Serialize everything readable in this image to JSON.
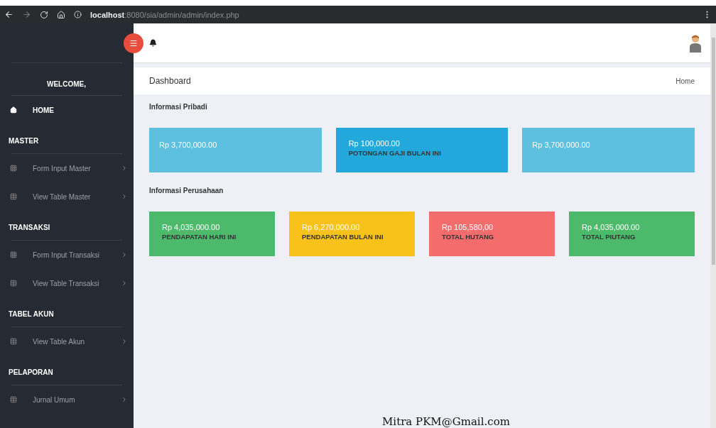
{
  "browser": {
    "url": "**localhost**:8080/sia/admin/admin/index.php"
  },
  "sidebar": {
    "welcome": "WELCOME,",
    "home": "HOME",
    "sections": [
      {
        "title": "MASTER",
        "items": [
          {
            "label": "Form Input Master",
            "kind": "form"
          },
          {
            "label": "View Table Master",
            "kind": "table"
          }
        ]
      },
      {
        "title": "TRANSAKSI",
        "items": [
          {
            "label": "Form Input Transaksi",
            "kind": "form"
          },
          {
            "label": "View Table Transaksi",
            "kind": "table"
          }
        ]
      },
      {
        "title": "TABEL AKUN",
        "items": [
          {
            "label": "View Table Akun",
            "kind": "table"
          }
        ]
      },
      {
        "title": "PELAPORAN",
        "items": [
          {
            "label": "Jurnal Umum",
            "kind": "table"
          }
        ]
      }
    ]
  },
  "breadcrumb": {
    "title": "Dashboard",
    "link": "Home"
  },
  "sections": [
    {
      "title": "Informasi Pribadi",
      "cards": [
        {
          "amount": "Rp 3,700,000.00",
          "color": "#5cc0de"
        },
        {
          "amount": "Rp 100,000.00",
          "label": "POTONGAN GAJI BULAN INI",
          "color": "#22a8da"
        },
        {
          "amount": "Rp 3,700,000.00",
          "color": "#5cc0de"
        }
      ]
    },
    {
      "title": "Informasi Perusahaan",
      "cards": [
        {
          "amount": "Rp 4,035,000.00",
          "label": "PENDAPATAN HARI INI",
          "color": "#4cb96b"
        },
        {
          "amount": "Rp 6,270,000.00",
          "label": "PENDAPATAN BULAN INI",
          "color": "#f9c21a"
        },
        {
          "amount": "Rp 105,580,00",
          "label": "TOTAL HUTANG",
          "color": "#f56c6c"
        },
        {
          "amount": "Rp 4,035,000.00",
          "label": "TOTAL PIUTANG",
          "color": "#4cb96b"
        }
      ]
    }
  ],
  "caption": "Mitra PKM@Gmail.com"
}
